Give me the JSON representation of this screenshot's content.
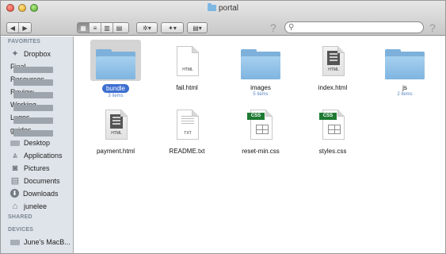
{
  "window": {
    "title": "portal"
  },
  "toolbar": {
    "back": "◀",
    "forward": "▶",
    "views": [
      "▦",
      "≡",
      "▥",
      "▤"
    ],
    "action": "✲▾",
    "dropbox": "✦▾",
    "arrange": "▤▾",
    "help_left": "?",
    "help_right": "?",
    "search_placeholder": ""
  },
  "sidebar": {
    "favorites_header": "FAVORITES",
    "favorites": [
      {
        "label": "Dropbox",
        "icon": "dropbox-icon"
      },
      {
        "label": "Final",
        "icon": "folder-icon"
      },
      {
        "label": "Resources",
        "icon": "folder-icon"
      },
      {
        "label": "Review",
        "icon": "folder-icon"
      },
      {
        "label": "Working",
        "icon": "folder-icon"
      },
      {
        "label": "Logos",
        "icon": "folder-icon"
      },
      {
        "label": "guides",
        "icon": "folder-icon"
      },
      {
        "label": "Desktop",
        "icon": "desktop-icon"
      },
      {
        "label": "Applications",
        "icon": "applications-icon"
      },
      {
        "label": "Pictures",
        "icon": "camera-icon"
      },
      {
        "label": "Documents",
        "icon": "documents-icon"
      },
      {
        "label": "Downloads",
        "icon": "downloads-icon"
      },
      {
        "label": "junelee",
        "icon": "home-icon"
      }
    ],
    "shared_header": "SHARED",
    "devices_header": "DEVICES",
    "devices": [
      {
        "label": "June's MacB...",
        "icon": "laptop-icon"
      }
    ]
  },
  "files": [
    {
      "name": "bundle",
      "sub": "3 items",
      "type": "folder",
      "selected": true
    },
    {
      "name": "fail.html",
      "sub": "",
      "type": "html",
      "tag": "HTML"
    },
    {
      "name": "images",
      "sub": "5 items",
      "type": "folder"
    },
    {
      "name": "index.html",
      "sub": "",
      "type": "html-preview",
      "tag": "HTML"
    },
    {
      "name": "js",
      "sub": "2 items",
      "type": "folder"
    },
    {
      "name": "payment.html",
      "sub": "",
      "type": "html-preview",
      "tag": "HTML"
    },
    {
      "name": "README.txt",
      "sub": "",
      "type": "txt",
      "tag": "TXT"
    },
    {
      "name": "reset-min.css",
      "sub": "",
      "type": "css",
      "tag": "CSS"
    },
    {
      "name": "styles.css",
      "sub": "",
      "type": "css",
      "tag": "CSS"
    }
  ]
}
